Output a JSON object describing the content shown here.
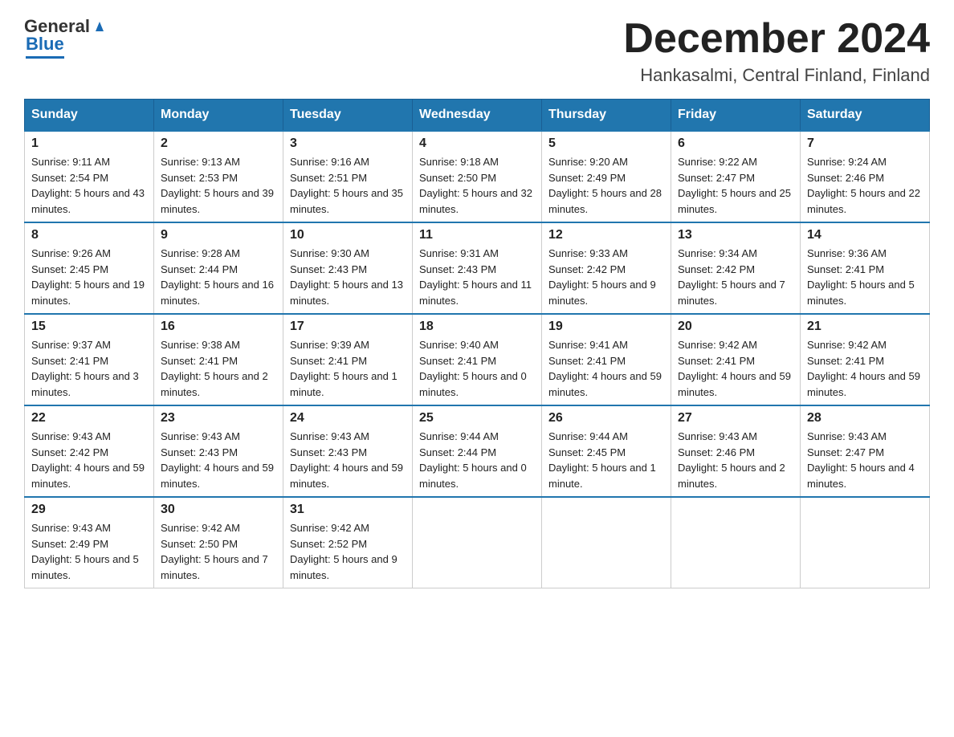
{
  "header": {
    "logo_general": "General",
    "logo_blue": "Blue",
    "month_title": "December 2024",
    "subtitle": "Hankasalmi, Central Finland, Finland"
  },
  "weekdays": [
    "Sunday",
    "Monday",
    "Tuesday",
    "Wednesday",
    "Thursday",
    "Friday",
    "Saturday"
  ],
  "weeks": [
    [
      {
        "day": "1",
        "sunrise": "9:11 AM",
        "sunset": "2:54 PM",
        "daylight": "5 hours and 43 minutes."
      },
      {
        "day": "2",
        "sunrise": "9:13 AM",
        "sunset": "2:53 PM",
        "daylight": "5 hours and 39 minutes."
      },
      {
        "day": "3",
        "sunrise": "9:16 AM",
        "sunset": "2:51 PM",
        "daylight": "5 hours and 35 minutes."
      },
      {
        "day": "4",
        "sunrise": "9:18 AM",
        "sunset": "2:50 PM",
        "daylight": "5 hours and 32 minutes."
      },
      {
        "day": "5",
        "sunrise": "9:20 AM",
        "sunset": "2:49 PM",
        "daylight": "5 hours and 28 minutes."
      },
      {
        "day": "6",
        "sunrise": "9:22 AM",
        "sunset": "2:47 PM",
        "daylight": "5 hours and 25 minutes."
      },
      {
        "day": "7",
        "sunrise": "9:24 AM",
        "sunset": "2:46 PM",
        "daylight": "5 hours and 22 minutes."
      }
    ],
    [
      {
        "day": "8",
        "sunrise": "9:26 AM",
        "sunset": "2:45 PM",
        "daylight": "5 hours and 19 minutes."
      },
      {
        "day": "9",
        "sunrise": "9:28 AM",
        "sunset": "2:44 PM",
        "daylight": "5 hours and 16 minutes."
      },
      {
        "day": "10",
        "sunrise": "9:30 AM",
        "sunset": "2:43 PM",
        "daylight": "5 hours and 13 minutes."
      },
      {
        "day": "11",
        "sunrise": "9:31 AM",
        "sunset": "2:43 PM",
        "daylight": "5 hours and 11 minutes."
      },
      {
        "day": "12",
        "sunrise": "9:33 AM",
        "sunset": "2:42 PM",
        "daylight": "5 hours and 9 minutes."
      },
      {
        "day": "13",
        "sunrise": "9:34 AM",
        "sunset": "2:42 PM",
        "daylight": "5 hours and 7 minutes."
      },
      {
        "day": "14",
        "sunrise": "9:36 AM",
        "sunset": "2:41 PM",
        "daylight": "5 hours and 5 minutes."
      }
    ],
    [
      {
        "day": "15",
        "sunrise": "9:37 AM",
        "sunset": "2:41 PM",
        "daylight": "5 hours and 3 minutes."
      },
      {
        "day": "16",
        "sunrise": "9:38 AM",
        "sunset": "2:41 PM",
        "daylight": "5 hours and 2 minutes."
      },
      {
        "day": "17",
        "sunrise": "9:39 AM",
        "sunset": "2:41 PM",
        "daylight": "5 hours and 1 minute."
      },
      {
        "day": "18",
        "sunrise": "9:40 AM",
        "sunset": "2:41 PM",
        "daylight": "5 hours and 0 minutes."
      },
      {
        "day": "19",
        "sunrise": "9:41 AM",
        "sunset": "2:41 PM",
        "daylight": "4 hours and 59 minutes."
      },
      {
        "day": "20",
        "sunrise": "9:42 AM",
        "sunset": "2:41 PM",
        "daylight": "4 hours and 59 minutes."
      },
      {
        "day": "21",
        "sunrise": "9:42 AM",
        "sunset": "2:41 PM",
        "daylight": "4 hours and 59 minutes."
      }
    ],
    [
      {
        "day": "22",
        "sunrise": "9:43 AM",
        "sunset": "2:42 PM",
        "daylight": "4 hours and 59 minutes."
      },
      {
        "day": "23",
        "sunrise": "9:43 AM",
        "sunset": "2:43 PM",
        "daylight": "4 hours and 59 minutes."
      },
      {
        "day": "24",
        "sunrise": "9:43 AM",
        "sunset": "2:43 PM",
        "daylight": "4 hours and 59 minutes."
      },
      {
        "day": "25",
        "sunrise": "9:44 AM",
        "sunset": "2:44 PM",
        "daylight": "5 hours and 0 minutes."
      },
      {
        "day": "26",
        "sunrise": "9:44 AM",
        "sunset": "2:45 PM",
        "daylight": "5 hours and 1 minute."
      },
      {
        "day": "27",
        "sunrise": "9:43 AM",
        "sunset": "2:46 PM",
        "daylight": "5 hours and 2 minutes."
      },
      {
        "day": "28",
        "sunrise": "9:43 AM",
        "sunset": "2:47 PM",
        "daylight": "5 hours and 4 minutes."
      }
    ],
    [
      {
        "day": "29",
        "sunrise": "9:43 AM",
        "sunset": "2:49 PM",
        "daylight": "5 hours and 5 minutes."
      },
      {
        "day": "30",
        "sunrise": "9:42 AM",
        "sunset": "2:50 PM",
        "daylight": "5 hours and 7 minutes."
      },
      {
        "day": "31",
        "sunrise": "9:42 AM",
        "sunset": "2:52 PM",
        "daylight": "5 hours and 9 minutes."
      },
      null,
      null,
      null,
      null
    ]
  ]
}
